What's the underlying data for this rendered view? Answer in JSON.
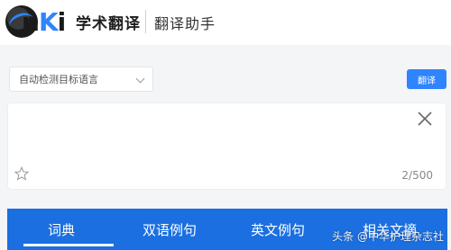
{
  "header": {
    "logo_text_prefix": "n",
    "logo_text_accent": "K",
    "logo_text_suffix": "i",
    "app_name": "学术翻译",
    "sub_title": "翻译助手"
  },
  "toolbar": {
    "language_select_value": "自动检测目标语言",
    "translate_label": "翻译"
  },
  "input": {
    "value": "",
    "char_count": "2/500"
  },
  "tabs": [
    {
      "label": "词典"
    },
    {
      "label": "双语例句"
    },
    {
      "label": "英文例句"
    },
    {
      "label": "相关文摘"
    }
  ],
  "watermark": {
    "text": "头条 @中华护理杂志社"
  },
  "colors": {
    "accent": "#2f84ff",
    "tab_bar": "#1b6fe0",
    "page_bg": "#f4f5f7"
  }
}
